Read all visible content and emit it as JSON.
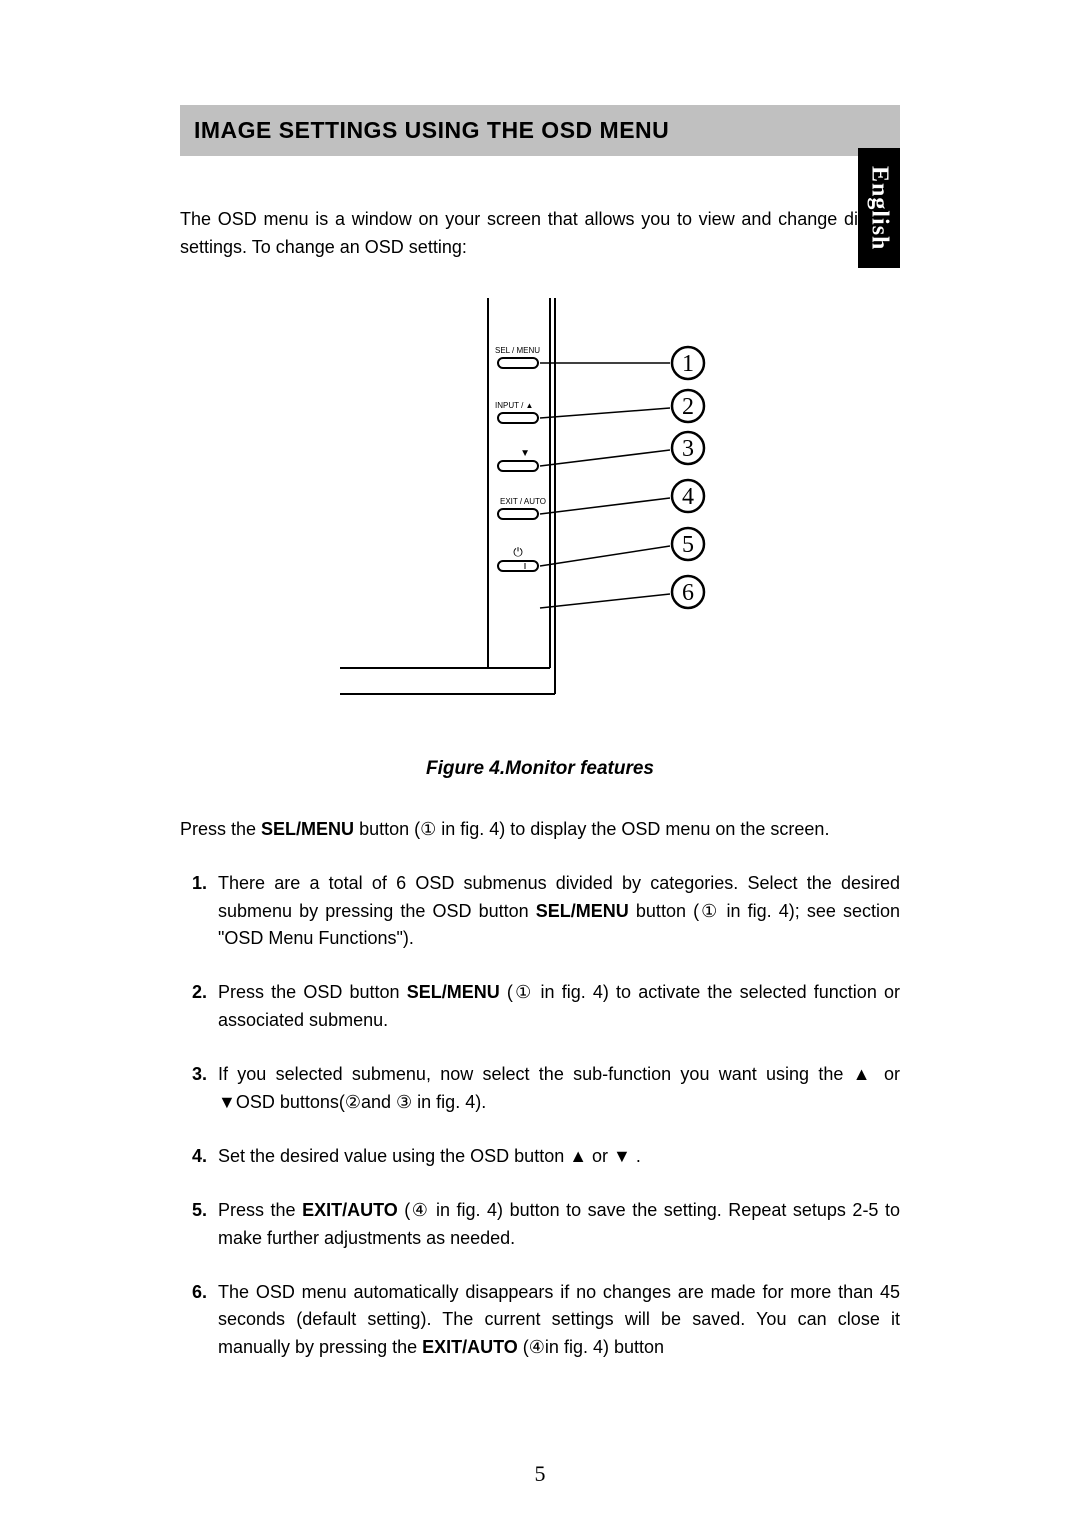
{
  "section_title": "IMAGE SETTINGS USING THE OSD MENU",
  "lang_tab": "English",
  "intro": "The OSD menu is a window on your screen that allows you to view and change display settings. To change an OSD setting:",
  "figure": {
    "labels": {
      "sel_menu": "SEL / MENU",
      "input_up": "INPUT / ▲",
      "down": "▼",
      "exit_auto": "EXIT / AUTO",
      "power": "⏻"
    },
    "callouts": [
      "1",
      "2",
      "3",
      "4",
      "5",
      "6"
    ],
    "caption_prefix": "Figure 4.",
    "caption_text": "Monitor features"
  },
  "press_line": {
    "pre": "Press the ",
    "btn": "SEL/MENU",
    "post": " button (① in fig. 4) to display the OSD menu on the screen."
  },
  "steps": [
    {
      "pre": "There are a total of 6 OSD submenus divided by categories. Select the desired submenu by pressing the OSD button ",
      "btn": "SEL/MENU",
      "post": " button (① in fig. 4); see section \"OSD Menu Functions\")."
    },
    {
      "pre": "Press the OSD button ",
      "btn": "SEL/MENU",
      "post": " (① in fig. 4) to activate the selected function or associated submenu."
    },
    {
      "text": "If you selected submenu, now select the sub-function you want using the ▲ or ▼OSD buttons(②and ③ in fig. 4)."
    },
    {
      "text": "Set the desired value using the OSD button ▲ or ▼ ."
    },
    {
      "pre": "Press the ",
      "btn": "EXIT/AUTO",
      "post": " (④ in fig. 4) button to save the setting. Repeat setups 2-5 to make further adjustments as needed."
    },
    {
      "pre": "The OSD menu automatically disappears if no changes are made for more than 45 seconds (default setting). The current settings will be saved. You can close it manually by pressing the ",
      "btn": "EXIT/AUTO",
      "post": " (④in fig. 4) button"
    }
  ],
  "page_number": "5"
}
